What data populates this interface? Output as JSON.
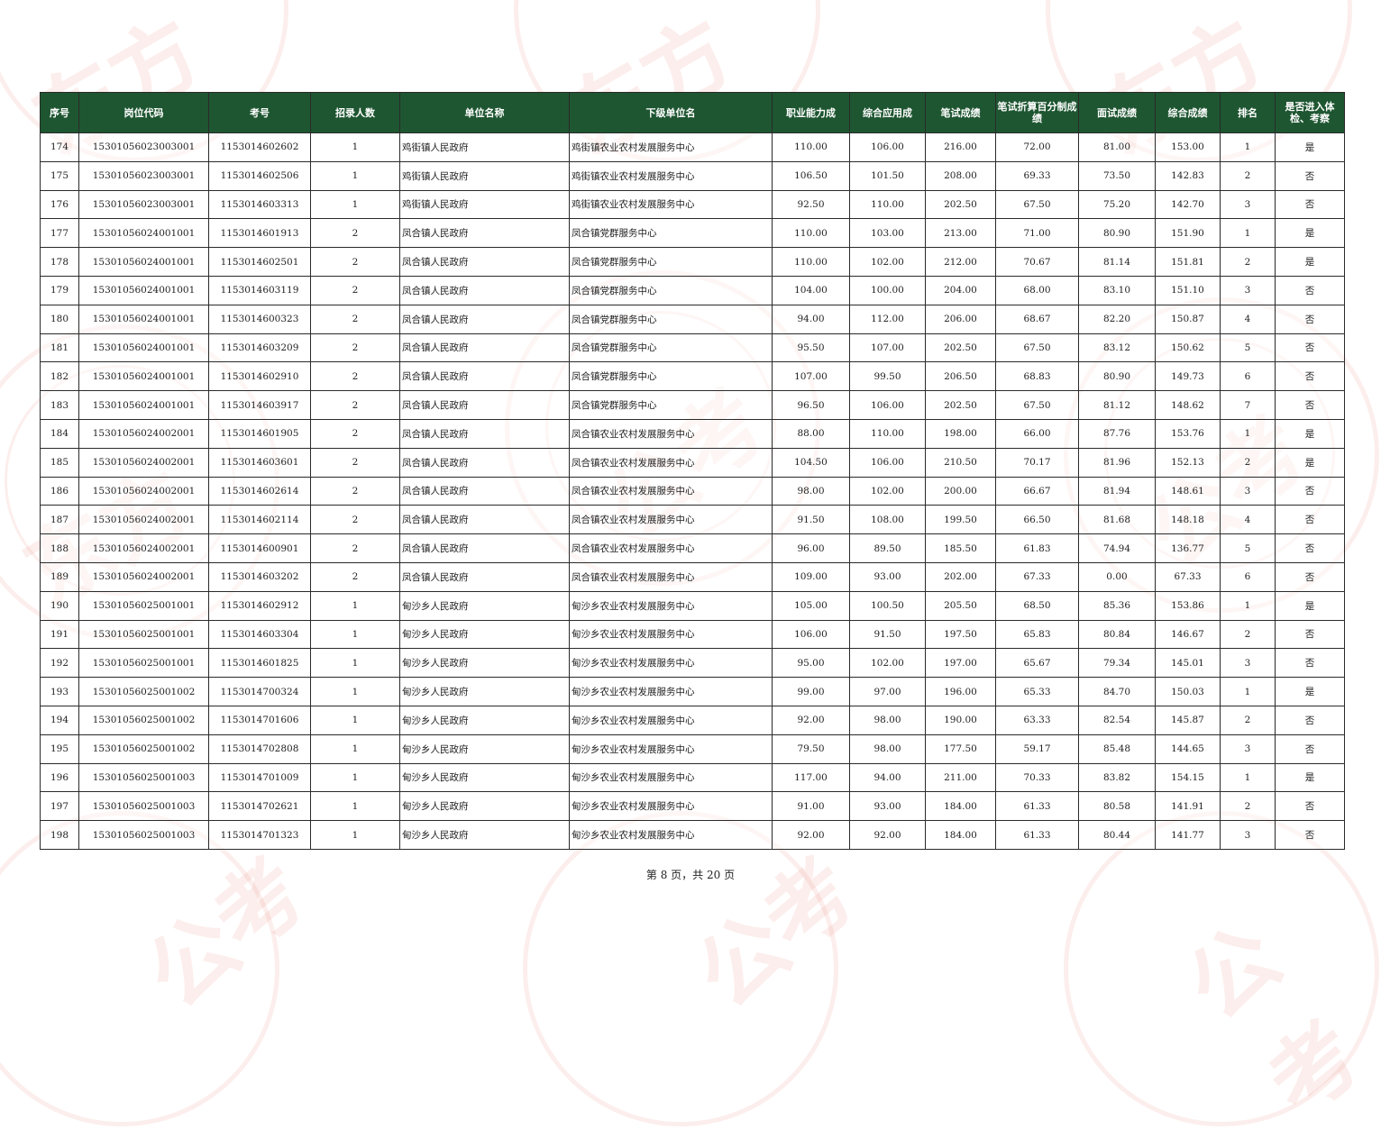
{
  "table": {
    "headers": [
      "序号",
      "岗位代码",
      "考号",
      "招录人数",
      "单位名称",
      "下级单位名",
      "职业能力成",
      "综合应用成",
      "笔试成绩",
      "笔试折算百分制成绩",
      "面试成绩",
      "综合成绩",
      "排名",
      "是否进入体检、考察"
    ],
    "rows": [
      [
        "174",
        "15301056023003001",
        "1153014602602",
        "1",
        "鸡街镇人民政府",
        "鸡街镇农业农村发展服务中心",
        "110.00",
        "106.00",
        "216.00",
        "72.00",
        "81.00",
        "153.00",
        "1",
        "是"
      ],
      [
        "175",
        "15301056023003001",
        "1153014602506",
        "1",
        "鸡街镇人民政府",
        "鸡街镇农业农村发展服务中心",
        "106.50",
        "101.50",
        "208.00",
        "69.33",
        "73.50",
        "142.83",
        "2",
        "否"
      ],
      [
        "176",
        "15301056023003001",
        "1153014603313",
        "1",
        "鸡街镇人民政府",
        "鸡街镇农业农村发展服务中心",
        "92.50",
        "110.00",
        "202.50",
        "67.50",
        "75.20",
        "142.70",
        "3",
        "否"
      ],
      [
        "177",
        "15301056024001001",
        "1153014601913",
        "2",
        "凤合镇人民政府",
        "凤合镇党群服务中心",
        "110.00",
        "103.00",
        "213.00",
        "71.00",
        "80.90",
        "151.90",
        "1",
        "是"
      ],
      [
        "178",
        "15301056024001001",
        "1153014602501",
        "2",
        "凤合镇人民政府",
        "凤合镇党群服务中心",
        "110.00",
        "102.00",
        "212.00",
        "70.67",
        "81.14",
        "151.81",
        "2",
        "是"
      ],
      [
        "179",
        "15301056024001001",
        "1153014603119",
        "2",
        "凤合镇人民政府",
        "凤合镇党群服务中心",
        "104.00",
        "100.00",
        "204.00",
        "68.00",
        "83.10",
        "151.10",
        "3",
        "否"
      ],
      [
        "180",
        "15301056024001001",
        "1153014600323",
        "2",
        "凤合镇人民政府",
        "凤合镇党群服务中心",
        "94.00",
        "112.00",
        "206.00",
        "68.67",
        "82.20",
        "150.87",
        "4",
        "否"
      ],
      [
        "181",
        "15301056024001001",
        "1153014603209",
        "2",
        "凤合镇人民政府",
        "凤合镇党群服务中心",
        "95.50",
        "107.00",
        "202.50",
        "67.50",
        "83.12",
        "150.62",
        "5",
        "否"
      ],
      [
        "182",
        "15301056024001001",
        "1153014602910",
        "2",
        "凤合镇人民政府",
        "凤合镇党群服务中心",
        "107.00",
        "99.50",
        "206.50",
        "68.83",
        "80.90",
        "149.73",
        "6",
        "否"
      ],
      [
        "183",
        "15301056024001001",
        "1153014603917",
        "2",
        "凤合镇人民政府",
        "凤合镇党群服务中心",
        "96.50",
        "106.00",
        "202.50",
        "67.50",
        "81.12",
        "148.62",
        "7",
        "否"
      ],
      [
        "184",
        "15301056024002001",
        "1153014601905",
        "2",
        "凤合镇人民政府",
        "凤合镇农业农村发展服务中心",
        "88.00",
        "110.00",
        "198.00",
        "66.00",
        "87.76",
        "153.76",
        "1",
        "是"
      ],
      [
        "185",
        "15301056024002001",
        "1153014603601",
        "2",
        "凤合镇人民政府",
        "凤合镇农业农村发展服务中心",
        "104.50",
        "106.00",
        "210.50",
        "70.17",
        "81.96",
        "152.13",
        "2",
        "是"
      ],
      [
        "186",
        "15301056024002001",
        "1153014602614",
        "2",
        "凤合镇人民政府",
        "凤合镇农业农村发展服务中心",
        "98.00",
        "102.00",
        "200.00",
        "66.67",
        "81.94",
        "148.61",
        "3",
        "否"
      ],
      [
        "187",
        "15301056024002001",
        "1153014602114",
        "2",
        "凤合镇人民政府",
        "凤合镇农业农村发展服务中心",
        "91.50",
        "108.00",
        "199.50",
        "66.50",
        "81.68",
        "148.18",
        "4",
        "否"
      ],
      [
        "188",
        "15301056024002001",
        "1153014600901",
        "2",
        "凤合镇人民政府",
        "凤合镇农业农村发展服务中心",
        "96.00",
        "89.50",
        "185.50",
        "61.83",
        "74.94",
        "136.77",
        "5",
        "否"
      ],
      [
        "189",
        "15301056024002001",
        "1153014603202",
        "2",
        "凤合镇人民政府",
        "凤合镇农业农村发展服务中心",
        "109.00",
        "93.00",
        "202.00",
        "67.33",
        "0.00",
        "67.33",
        "6",
        "否"
      ],
      [
        "190",
        "15301056025001001",
        "1153014602912",
        "1",
        "甸沙乡人民政府",
        "甸沙乡农业农村发展服务中心",
        "105.00",
        "100.50",
        "205.50",
        "68.50",
        "85.36",
        "153.86",
        "1",
        "是"
      ],
      [
        "191",
        "15301056025001001",
        "1153014603304",
        "1",
        "甸沙乡人民政府",
        "甸沙乡农业农村发展服务中心",
        "106.00",
        "91.50",
        "197.50",
        "65.83",
        "80.84",
        "146.67",
        "2",
        "否"
      ],
      [
        "192",
        "15301056025001001",
        "1153014601825",
        "1",
        "甸沙乡人民政府",
        "甸沙乡农业农村发展服务中心",
        "95.00",
        "102.00",
        "197.00",
        "65.67",
        "79.34",
        "145.01",
        "3",
        "否"
      ],
      [
        "193",
        "15301056025001002",
        "1153014700324",
        "1",
        "甸沙乡人民政府",
        "甸沙乡农业农村发展服务中心",
        "99.00",
        "97.00",
        "196.00",
        "65.33",
        "84.70",
        "150.03",
        "1",
        "是"
      ],
      [
        "194",
        "15301056025001002",
        "1153014701606",
        "1",
        "甸沙乡人民政府",
        "甸沙乡农业农村发展服务中心",
        "92.00",
        "98.00",
        "190.00",
        "63.33",
        "82.54",
        "145.87",
        "2",
        "否"
      ],
      [
        "195",
        "15301056025001002",
        "1153014702808",
        "1",
        "甸沙乡人民政府",
        "甸沙乡农业农村发展服务中心",
        "79.50",
        "98.00",
        "177.50",
        "59.17",
        "85.48",
        "144.65",
        "3",
        "否"
      ],
      [
        "196",
        "15301056025001003",
        "1153014701009",
        "1",
        "甸沙乡人民政府",
        "甸沙乡农业农村发展服务中心",
        "117.00",
        "94.00",
        "211.00",
        "70.33",
        "83.82",
        "154.15",
        "1",
        "是"
      ],
      [
        "197",
        "15301056025001003",
        "1153014702621",
        "1",
        "甸沙乡人民政府",
        "甸沙乡农业农村发展服务中心",
        "91.00",
        "93.00",
        "184.00",
        "61.33",
        "80.58",
        "141.91",
        "2",
        "否"
      ],
      [
        "198",
        "15301056025001003",
        "1153014701323",
        "1",
        "甸沙乡人民政府",
        "甸沙乡农业农村发展服务中心",
        "92.00",
        "92.00",
        "184.00",
        "61.33",
        "80.44",
        "141.77",
        "3",
        "否"
      ]
    ]
  },
  "footer": {
    "page_label": "第 8 页，共 20 页"
  },
  "watermark": {
    "logo_text": [
      "东方公考",
      "东方公考",
      "东方公考",
      "东方公考",
      "东方公考",
      "东方公考",
      "东方公考",
      "东方公考",
      "东方公考"
    ]
  },
  "colors": {
    "header_bg": "#1e5631",
    "header_text": "#ffffff",
    "watermark": "#e8786e"
  }
}
